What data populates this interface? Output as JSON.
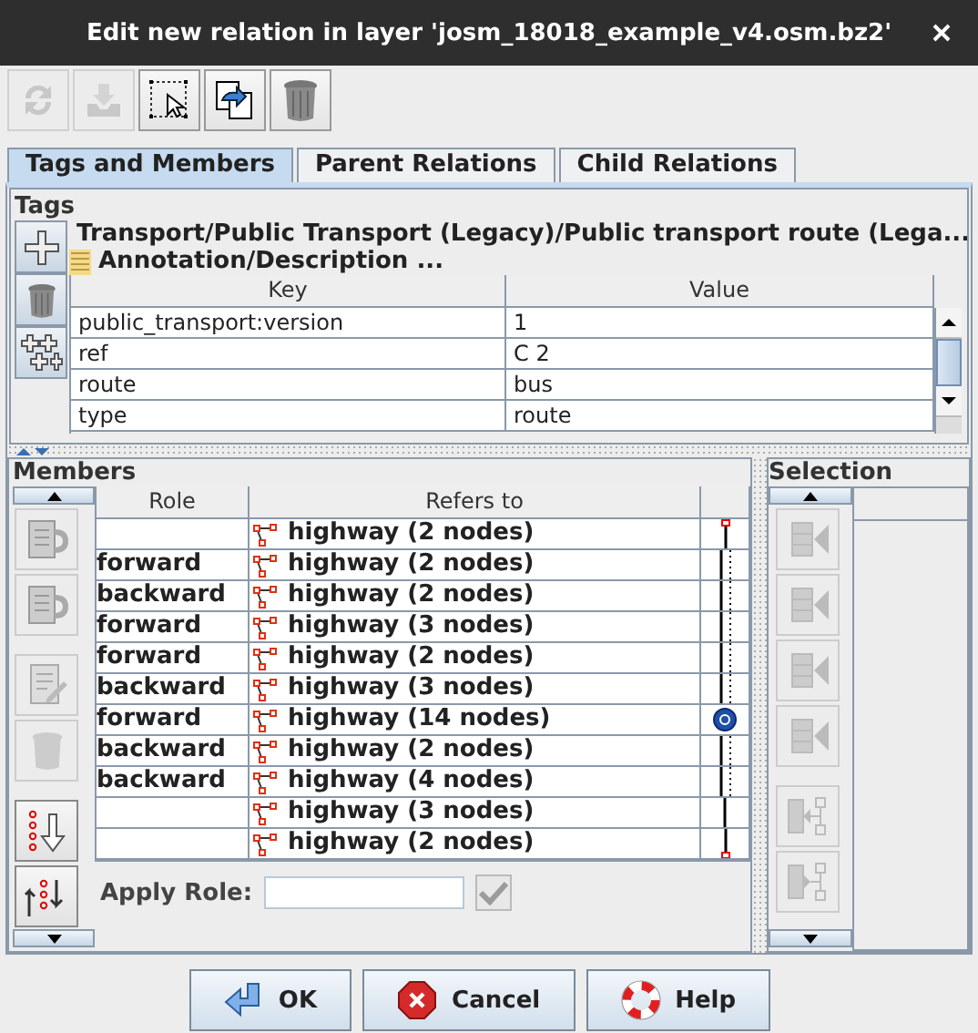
{
  "window": {
    "title": "Edit new relation in layer 'josm_18018_example_v4.osm.bz2'"
  },
  "toolbar": [
    {
      "kind": "refresh",
      "disabled": true
    },
    {
      "kind": "save",
      "disabled": true
    },
    {
      "kind": "select",
      "disabled": false
    },
    {
      "kind": "zoom",
      "disabled": false
    },
    {
      "kind": "delete",
      "disabled": false
    }
  ],
  "tabs": [
    {
      "label": "Tags and Members",
      "selected": true
    },
    {
      "label": "Parent Relations",
      "selected": false
    },
    {
      "label": "Child Relations",
      "selected": false
    }
  ],
  "tags": {
    "title": "Tags",
    "tools": [
      {
        "kind": "add"
      },
      {
        "kind": "delete"
      },
      {
        "kind": "paste"
      }
    ],
    "presets": [
      {
        "kind": "transport",
        "label": "Transport/Public Transport (Legacy)/Public transport route (Lega..."
      },
      {
        "kind": "note",
        "label": "Annotation/Description ..."
      }
    ],
    "columns": [
      "Key",
      "Value"
    ],
    "rows": [
      {
        "key": "public_transport:version",
        "value": "1"
      },
      {
        "key": "ref",
        "value": "C 2"
      },
      {
        "key": "route",
        "value": "bus"
      },
      {
        "key": "type",
        "value": "route"
      }
    ]
  },
  "members": {
    "title": "Members",
    "tools": [
      {
        "kind": "move-up",
        "disabled": true
      },
      {
        "kind": "move-down",
        "disabled": true
      },
      {
        "kind": "edit",
        "disabled": true
      },
      {
        "kind": "delete",
        "disabled": true
      },
      {
        "kind": "sort",
        "disabled": false
      },
      {
        "kind": "reverse",
        "disabled": false
      }
    ],
    "columns": [
      "Role",
      "Refers to"
    ],
    "rows": [
      {
        "refers_to": "highway (2 nodes)",
        "kind": "start"
      },
      {
        "role": "forward",
        "refers_to": "highway (2 nodes)",
        "kind": "split"
      },
      {
        "role": "backward",
        "refers_to": "highway (2 nodes)",
        "kind": "split"
      },
      {
        "role": "forward",
        "refers_to": "highway (3 nodes)",
        "kind": "split"
      },
      {
        "role": "forward",
        "refers_to": "highway (2 nodes)",
        "kind": "split"
      },
      {
        "role": "backward",
        "refers_to": "highway (3 nodes)",
        "kind": "split"
      },
      {
        "role": "forward",
        "refers_to": "highway (14 nodes)",
        "kind": "roundabout"
      },
      {
        "role": "backward",
        "refers_to": "highway (2 nodes)",
        "kind": "split"
      },
      {
        "role": "backward",
        "refers_to": "highway (4 nodes)",
        "kind": "split"
      },
      {
        "refers_to": "highway (3 nodes)",
        "kind": "line"
      },
      {
        "refers_to": "highway (2 nodes)",
        "kind": "end"
      }
    ],
    "apply_role": {
      "label": "Apply Role:",
      "button_disabled": true
    }
  },
  "selection": {
    "title": "Selection",
    "tools": [
      {
        "kind": "add-list",
        "disabled": true
      },
      {
        "kind": "add-list",
        "disabled": true
      },
      {
        "kind": "add-list",
        "disabled": true
      },
      {
        "kind": "add-list",
        "disabled": true
      },
      {
        "kind": "tree-left",
        "disabled": true
      },
      {
        "kind": "tree-right",
        "disabled": true
      }
    ]
  },
  "buttons": [
    {
      "kind": "ok",
      "label": "OK"
    },
    {
      "kind": "cancel",
      "label": "Cancel"
    },
    {
      "kind": "help",
      "label": "Help"
    }
  ]
}
